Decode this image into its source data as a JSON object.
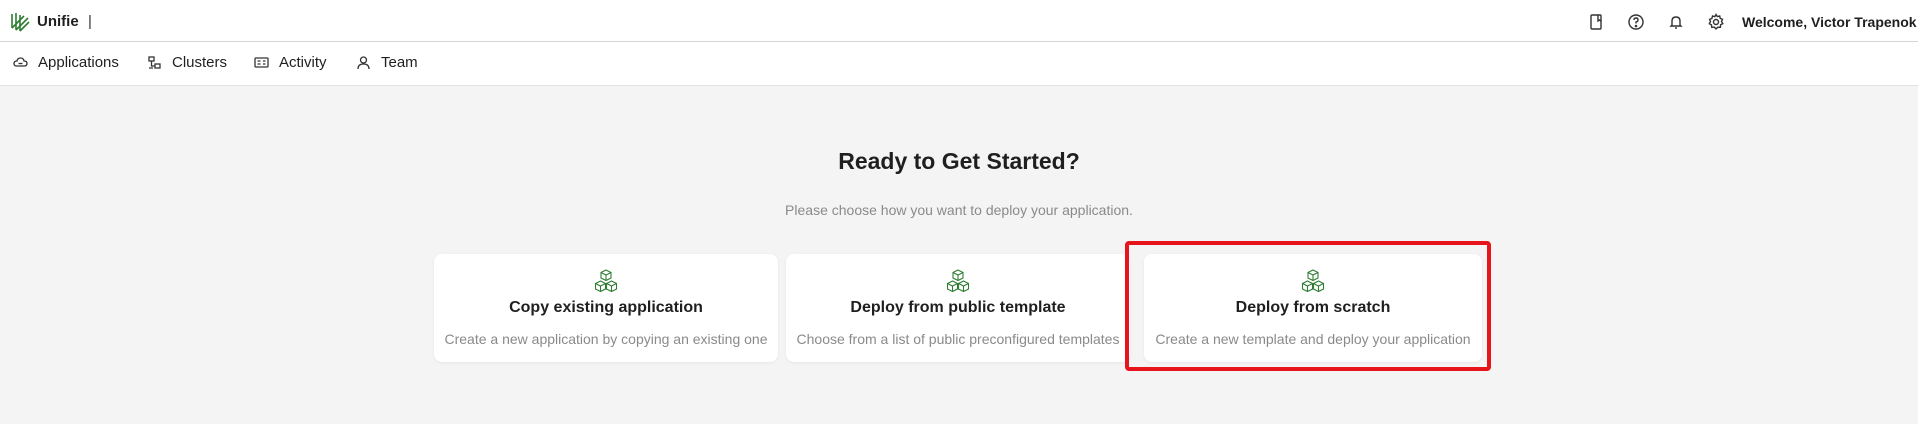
{
  "header": {
    "brand": "Unifie",
    "separator": "|",
    "icons": [
      "book-icon",
      "help-icon",
      "bell-icon",
      "settings-icon"
    ],
    "welcome": "Welcome, Victor Trapenok"
  },
  "nav": {
    "items": [
      {
        "label": "Applications",
        "icon": "cloud-icon"
      },
      {
        "label": "Clusters",
        "icon": "cluster-icon"
      },
      {
        "label": "Activity",
        "icon": "activity-icon"
      },
      {
        "label": "Team",
        "icon": "user-icon"
      }
    ]
  },
  "main": {
    "heading": "Ready to Get Started?",
    "subheading": "Please choose how you want to deploy your application.",
    "cards": [
      {
        "title": "Copy existing application",
        "description": "Create a new application by copying an existing one",
        "icon": "cubes-icon"
      },
      {
        "title": "Deploy from public template",
        "description": "Choose from a list of public preconfigured templates",
        "icon": "cubes-icon"
      },
      {
        "title": "Deploy from scratch",
        "description": "Create a new template and deploy your application",
        "icon": "cubes-icon"
      }
    ]
  },
  "colors": {
    "accent": "#2e7d32",
    "highlight": "#e8141b",
    "background": "#f4f4f4"
  }
}
